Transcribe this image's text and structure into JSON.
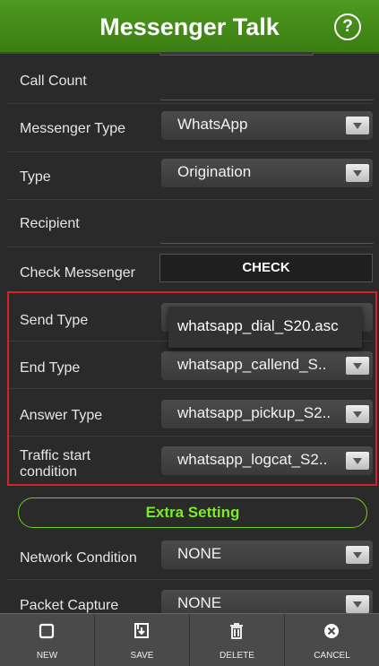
{
  "header": {
    "title": "Messenger Talk",
    "help_icon": "?"
  },
  "labels": {
    "call_count": "Call Count",
    "messenger_type": "Messenger Type",
    "type": "Type",
    "recipient": "Recipient",
    "check_messenger": "Check Messenger",
    "send_type": "Send Type",
    "end_type": "End Type",
    "answer_type": "Answer Type",
    "traffic_start": "Traffic start condition",
    "network_condition": "Network Condition",
    "packet_capture": "Packet Capture"
  },
  "values": {
    "messenger_type": "WhatsApp",
    "type": "Origination",
    "end_type": "whatsapp_callend_S..",
    "answer_type": "whatsapp_pickup_S2..",
    "traffic_start": "whatsapp_logcat_S2..",
    "network_condition": "NONE",
    "packet_capture": "NONE"
  },
  "buttons": {
    "check": "CHECK",
    "extra_setting": "Extra Setting"
  },
  "popup": {
    "text": "whatsapp_dial_S20.asc"
  },
  "toolbar": {
    "new": "NEW",
    "save": "SAVE",
    "delete": "DELETE",
    "cancel": "CANCEL"
  },
  "colors": {
    "header_green": "#3b7d13",
    "accent_green": "#7ee82b",
    "highlight_red": "#d3232a"
  }
}
